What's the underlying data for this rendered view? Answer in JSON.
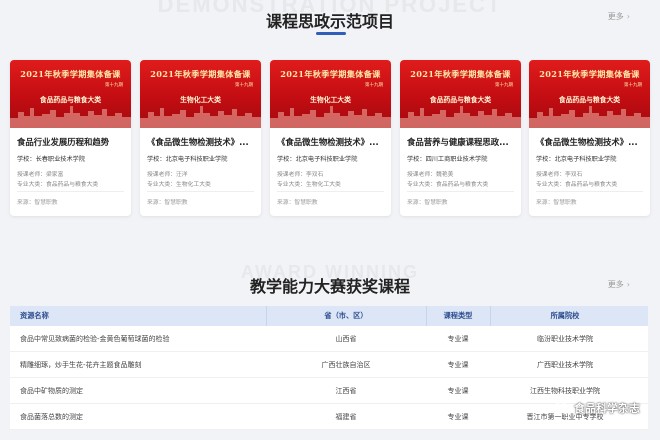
{
  "section1": {
    "watermark": "DEMONSTRATION PROJECT",
    "title": "课程思政示范项目",
    "more": "更多"
  },
  "banner": {
    "title": "2021年秋季学期集体备课",
    "session": "第十九期"
  },
  "labels": {
    "school": "学校：",
    "teacher": "授课老师：",
    "major": "专业大类：",
    "source": "来源：智慧职教"
  },
  "cards": [
    {
      "banner_sub": "食品药品与粮食大类",
      "course": "食品行业发展历程和趋势",
      "school": "长春职业技术学院",
      "teacher": "梁家富",
      "major": "食品药品与粮食大类"
    },
    {
      "banner_sub": "生物化工大类",
      "course": "《食品微生物检测技术》...",
      "school": "北京电子科技职业学院",
      "teacher": "汪洋",
      "major": "生物化工大类"
    },
    {
      "banner_sub": "生物化工大类",
      "course": "《食品微生物检测技术》...",
      "school": "北京电子科技职业学院",
      "teacher": "李双石",
      "major": "生物化工大类"
    },
    {
      "banner_sub": "食品药品与粮食大类",
      "course": "食品营养与健康课程思政...",
      "school": "四川工商职业技术学院",
      "teacher": "魏艳美",
      "major": "食品药品与粮食大类"
    },
    {
      "banner_sub": "食品药品与粮食大类",
      "course": "《食品微生物检测技术》...",
      "school": "北京电子科技职业学院",
      "teacher": "李双石",
      "major": "食品药品与粮食大类"
    }
  ],
  "section2": {
    "watermark": "AWARD WINNING",
    "title": "教学能力大赛获奖课程",
    "more": "更多"
  },
  "table": {
    "headers": [
      "资源名称",
      "省（市、区）",
      "课程类型",
      "所属院校"
    ],
    "rows": [
      [
        "食品中常见致病菌的检验-金黄色葡萄球菌的检验",
        "山西省",
        "专业课",
        "临汾职业技术学院"
      ],
      [
        "精雕细琢，炒手生花-花卉主题食品雕刻",
        "广西壮族自治区",
        "专业课",
        "广西职业技术学院"
      ],
      [
        "食品中矿物质的测定",
        "江西省",
        "专业课",
        "江西生物科技职业学院"
      ],
      [
        "食品菌落总数的测定",
        "福建省",
        "专业课",
        "晋江市第一职业中专学校"
      ]
    ]
  },
  "wechat": {
    "label": "食品科学杂志",
    "icon": "wechat-icon"
  },
  "colors": {
    "accent": "#2f5fb8",
    "banner_red": "#c30d12",
    "banner_gold": "#ffe9a8",
    "table_header_bg": "#dde6f7"
  }
}
